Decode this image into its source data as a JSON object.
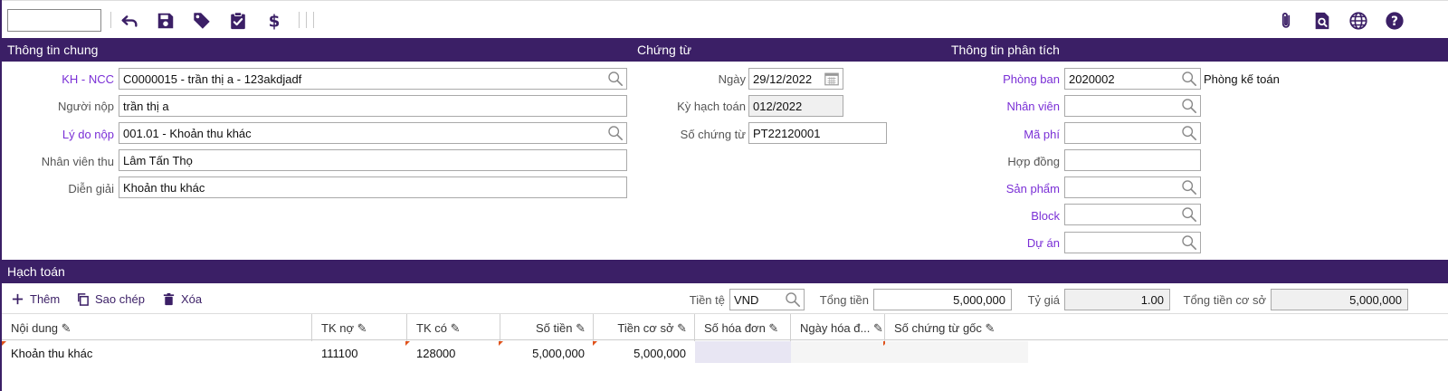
{
  "toolbar": {
    "search_value": "",
    "icons": [
      "undo-icon",
      "save-icon",
      "tag-icon",
      "clipboard-check-icon",
      "dollar-icon",
      "paperclip-icon",
      "document-search-icon",
      "globe-icon",
      "help-icon"
    ]
  },
  "sections": {
    "general": "Thông tin chung",
    "voucher": "Chứng từ",
    "analysis": "Thông tin phân tích",
    "accounting": "Hạch toán"
  },
  "general": {
    "customer_label": "KH - NCC",
    "customer_value": "C0000015 - trần thị a - 123akdjadf",
    "payer_label": "Người nộp",
    "payer_value": "trần thị a",
    "reason_label": "Lý do nộp",
    "reason_value": "001.01 - Khoản thu khác",
    "collector_label": "Nhân viên thu",
    "collector_value": "Lâm Tấn Thọ",
    "desc_label": "Diễn giải",
    "desc_value": "Khoản thu khác"
  },
  "voucher": {
    "date_label": "Ngày",
    "date_value": "29/12/2022",
    "period_label": "Kỳ hạch toán",
    "period_value": "012/2022",
    "number_label": "Số chứng từ",
    "number_value": "PT22120001"
  },
  "analysis": {
    "dept_label": "Phòng ban",
    "dept_value": "2020002",
    "dept_name": "Phòng kế toán",
    "staff_label": "Nhân viên",
    "staff_value": "",
    "fee_label": "Mã phí",
    "fee_value": "",
    "contract_label": "Hợp đồng",
    "contract_value": "",
    "product_label": "Sản phẩm",
    "product_value": "",
    "block_label": "Block",
    "block_value": "",
    "project_label": "Dự án",
    "project_value": ""
  },
  "grid_toolbar": {
    "add_label": "Thêm",
    "copy_label": "Sao chép",
    "delete_label": "Xóa",
    "currency_label": "Tiền tệ",
    "currency_value": "VND",
    "total_label": "Tổng tiền",
    "total_value": "5,000,000",
    "rate_label": "Tỷ giá",
    "rate_value": "1.00",
    "base_total_label": "Tổng tiền cơ sở",
    "base_total_value": "5,000,000"
  },
  "grid": {
    "columns": [
      "Nội dung",
      "TK nợ",
      "TK có",
      "Số tiền",
      "Tiền cơ sở",
      "Số hóa đơn",
      "Ngày hóa đ...",
      "Số chứng từ gốc"
    ],
    "rows": [
      [
        "Khoản thu khác",
        "111100",
        "128000",
        "5,000,000",
        "5,000,000",
        "",
        "",
        ""
      ]
    ]
  },
  "colors": {
    "primary": "#3b1f66",
    "link": "#7a2fd6",
    "flag": "#e0521b"
  }
}
